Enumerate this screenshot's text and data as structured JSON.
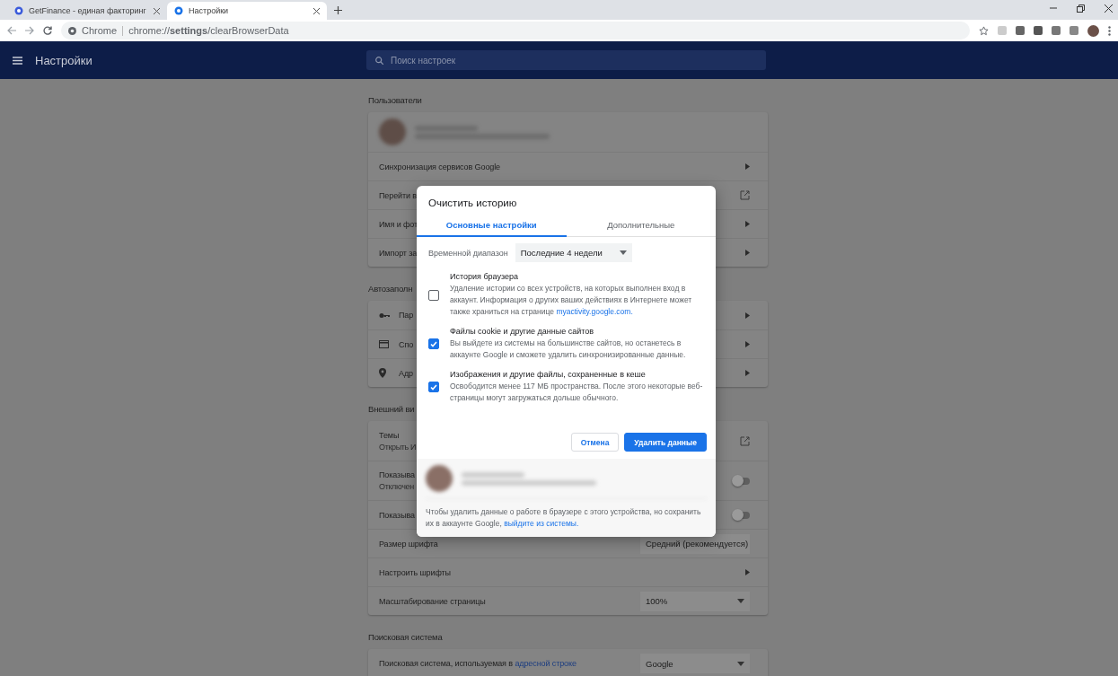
{
  "browser": {
    "tabs": [
      {
        "title": "GetFinance - единая факторинг",
        "selected": false
      },
      {
        "title": "Настройки",
        "selected": true
      }
    ],
    "address": {
      "origin": "Chrome",
      "url": "chrome://**settings**/clearBrowserData"
    }
  },
  "settings_header": {
    "title": "Настройки",
    "search_placeholder": "Поиск настроек"
  },
  "sections": [
    {
      "heading": "Пользователи",
      "rows": [
        {
          "kind": "profile"
        },
        {
          "kind": "arrow",
          "label": "Синхронизация сервисов Google"
        },
        {
          "kind": "external",
          "label": "Перейти в"
        },
        {
          "kind": "arrow",
          "label": "Имя и фот"
        },
        {
          "kind": "arrow",
          "label": "Импорт за"
        }
      ]
    },
    {
      "heading": "Автозаполн",
      "kind": "autofill",
      "rows": [
        {
          "kind": "arrow",
          "label": "Пар"
        },
        {
          "kind": "arrow",
          "label": "Спо"
        },
        {
          "kind": "arrow",
          "label": "Адр"
        }
      ]
    },
    {
      "heading": "Внешний ви",
      "rows": [
        {
          "kind": "external",
          "label": "Темы",
          "sublabel": "Открыть И"
        },
        {
          "kind": "toggle",
          "label": "Показыва",
          "sublabel": "Отключен",
          "on": false
        },
        {
          "kind": "toggle",
          "label": "Показыва",
          "on": false
        },
        {
          "kind": "select",
          "label": "Размер шрифта",
          "value": "Средний (рекомендуется)"
        },
        {
          "kind": "arrow",
          "label": "Настроить шрифты"
        },
        {
          "kind": "select",
          "label": "Масштабирование страницы",
          "value": "100%"
        }
      ]
    },
    {
      "heading": "Поисковая система",
      "rows": [
        {
          "kind": "select",
          "label": "Поисковая система, используемая в",
          "link": "адресной строке",
          "value": "Google"
        }
      ]
    }
  ],
  "dialog": {
    "title": "Очистить историю",
    "tabs": [
      {
        "label": "Основные настройки",
        "selected": true
      },
      {
        "label": "Дополнительные",
        "selected": false
      }
    ],
    "time_range": {
      "label": "Временной диапазон",
      "value": "Последние 4 недели"
    },
    "options": [
      {
        "title": "История браузера",
        "description": "Удаление истории со всех устройств, на которых выполнен вход в аккаунт. Информация о других ваших действиях в Интернете может также храниться на странице",
        "link": "myactivity.google.com.",
        "checked": false
      },
      {
        "title": "Файлы cookie и другие данные сайтов",
        "description": "Вы выйдете из системы на большинстве сайтов, но останетесь в аккаунте Google и сможете удалить синхронизированные данные.",
        "checked": true
      },
      {
        "title": "Изображения и другие файлы, сохраненные в кеше",
        "description": "Освободится менее 117 МБ пространства. После этого некоторые веб-страницы могут загружаться дольше обычного.",
        "checked": true
      }
    ],
    "buttons": {
      "cancel": "Отмена",
      "confirm": "Удалить данные"
    },
    "footer": {
      "text": "Чтобы удалить данные о работе в браузере с этого устройства, но сохранить их в аккаунте Google,",
      "link": "выйдите из системы."
    }
  }
}
